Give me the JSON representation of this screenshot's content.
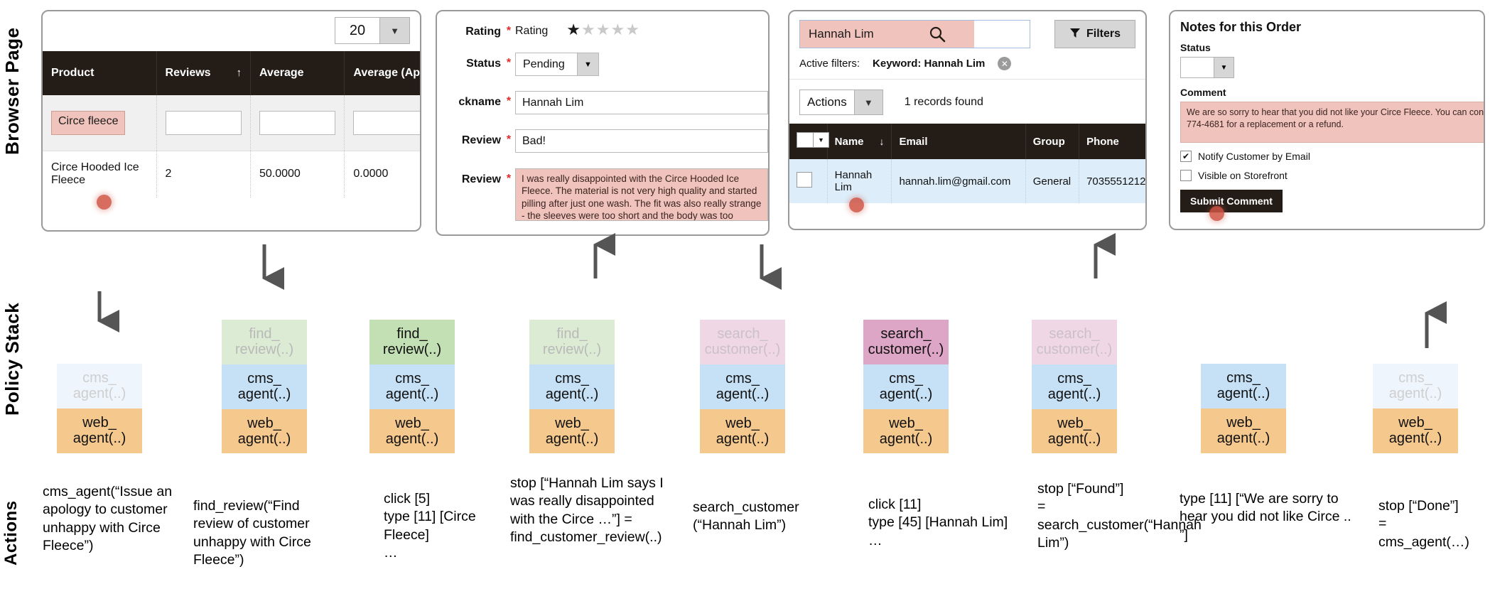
{
  "rows": {
    "browser_label": "Browser Page",
    "policy_label": "Policy Stack",
    "actions_label": "Actions"
  },
  "panel_reviews": {
    "page_size": "20",
    "dropdown_arrow": "▼",
    "columns": [
      "Product",
      "Reviews",
      "Average",
      "Average (Appro"
    ],
    "sort_indicator": "↑",
    "filter_values": [
      "Circe fleece",
      "",
      "",
      ""
    ],
    "data_row": [
      "Circe Hooded Ice Fleece",
      "2",
      "50.0000",
      "0.0000"
    ]
  },
  "panel_form": {
    "fields": [
      {
        "label": "Rating",
        "required": "*",
        "type": "stars",
        "value": "Rating",
        "stars_on": 1,
        "stars_total": 5
      },
      {
        "label": "Status",
        "required": "*",
        "type": "select",
        "value": "Pending"
      },
      {
        "label": "ckname",
        "required": "*",
        "type": "input",
        "value": "Hannah Lim"
      },
      {
        "label": "Review",
        "required": "*",
        "type": "input",
        "value": "Bad!"
      },
      {
        "label": "Review",
        "required": "*",
        "type": "textarea",
        "value": "I was really disappointed with the Circe Hooded Ice Fleece. The material is not very high quality and started pilling after just one wash. The fit was also really strange - the sleeves were too short and the body was too baggy, making me look"
      }
    ],
    "select_arrow": "▼",
    "star_filled": "★",
    "star_empty": "★"
  },
  "panel_grid": {
    "search_value": "Hannah Lim",
    "search_icon": "search-icon",
    "filters_label": "Filters",
    "active_filters_label": "Active filters:",
    "active_filter_chip": "Keyword: Hannah Lim",
    "chip_remove": "✕",
    "actions_label": "Actions",
    "actions_arrow": "▼",
    "records_found": "1 records found",
    "columns": [
      "",
      "Name",
      "Email",
      "Group",
      "Phone"
    ],
    "sort_indicator": "↓",
    "header_check_arrow": "▼",
    "row": {
      "name": "Hannah Lim",
      "email": "hannah.lim@gmail.com",
      "group": "General",
      "phone": "7035551212"
    }
  },
  "panel_notes": {
    "title": "Notes for this Order",
    "status_label": "Status",
    "status_value": "",
    "status_arrow": "▼",
    "comment_label": "Comment",
    "comment_line1": "We are so sorry to hear that you did not like your Circe Fleece. You can cont",
    "comment_line2": "774-4681 for a replacement or a refund.",
    "notify_label": "Notify Customer by Email",
    "notify_checked": "✔",
    "visible_label": "Visible on Storefront",
    "submit_label": "Submit Comment"
  },
  "policy_stack": [
    {
      "arrow": "down",
      "frames": [
        {
          "text": "cms_\nagent(..)",
          "color": "blue",
          "faded": true
        },
        {
          "text": "web_\nagent(..)",
          "color": "orange",
          "faded": false
        }
      ]
    },
    {
      "arrow": "down",
      "frames": [
        {
          "text": "find_\nreview(..)",
          "color": "green",
          "faded": true
        },
        {
          "text": "cms_\nagent(..)",
          "color": "blue",
          "faded": false
        },
        {
          "text": "web_\nagent(..)",
          "color": "orange",
          "faded": false
        }
      ]
    },
    {
      "arrow": "none",
      "frames": [
        {
          "text": "find_\nreview(..)",
          "color": "green",
          "faded": false
        },
        {
          "text": "cms_\nagent(..)",
          "color": "blue",
          "faded": false
        },
        {
          "text": "web_\nagent(..)",
          "color": "orange",
          "faded": false
        }
      ]
    },
    {
      "arrow": "up",
      "frames": [
        {
          "text": "find_\nreview(..)",
          "color": "green",
          "faded": true
        },
        {
          "text": "cms_\nagent(..)",
          "color": "blue",
          "faded": false
        },
        {
          "text": "web_\nagent(..)",
          "color": "orange",
          "faded": false
        }
      ]
    },
    {
      "arrow": "down",
      "frames": [
        {
          "text": "search_\ncustomer(..)",
          "color": "pink",
          "faded": true
        },
        {
          "text": "cms_\nagent(..)",
          "color": "blue",
          "faded": false
        },
        {
          "text": "web_\nagent(..)",
          "color": "orange",
          "faded": false
        }
      ]
    },
    {
      "arrow": "none",
      "frames": [
        {
          "text": "search_\ncustomer(..)",
          "color": "pink",
          "faded": false
        },
        {
          "text": "cms_\nagent(..)",
          "color": "blue",
          "faded": false
        },
        {
          "text": "web_\nagent(..)",
          "color": "orange",
          "faded": false
        }
      ]
    },
    {
      "arrow": "up",
      "frames": [
        {
          "text": "search_\ncustomer(..)",
          "color": "pink",
          "faded": true
        },
        {
          "text": "cms_\nagent(..)",
          "color": "blue",
          "faded": false
        },
        {
          "text": "web_\nagent(..)",
          "color": "orange",
          "faded": false
        }
      ]
    },
    {
      "arrow": "none",
      "frames": [
        {
          "text": "cms_\nagent(..)",
          "color": "blue",
          "faded": false
        },
        {
          "text": "web_\nagent(..)",
          "color": "orange",
          "faded": false
        }
      ]
    },
    {
      "arrow": "up",
      "frames": [
        {
          "text": "cms_\nagent(..)",
          "color": "blue",
          "faded": true
        },
        {
          "text": "web_\nagent(..)",
          "color": "orange",
          "faded": false
        }
      ]
    }
  ],
  "actions": [
    "cms_agent(“Issue an apology to customer unhappy with Circe Fleece”)",
    "find_review(“Find review of customer unhappy with Circe Fleece”)",
    "click [5]\ntype [11] [Circe Fleece]\n…",
    "stop [“Hannah Lim says I was really disappointed with the Circe …”] = find_customer_review(..)",
    "search_customer (“Hannah Lim”)",
    "click [11]\ntype [45] [Hannah Lim]\n…",
    "stop [“Found”]\n=\nsearch_customer(“Hannah Lim”)",
    "type [11] [“We are sorry to hear you did not like Circe .. ”]",
    "stop [“Done”]\n=\ncms_agent(…)"
  ],
  "colors": {
    "header_dark": "#241c16",
    "highlight_pink": "#f0c4bd",
    "row_blue": "#ddeefa",
    "frame_green": "#c3e0b4",
    "frame_pink": "#dda5c6",
    "frame_blue": "#c6e0f5",
    "frame_orange": "#f5c98e",
    "cursor": "#cf5444"
  }
}
